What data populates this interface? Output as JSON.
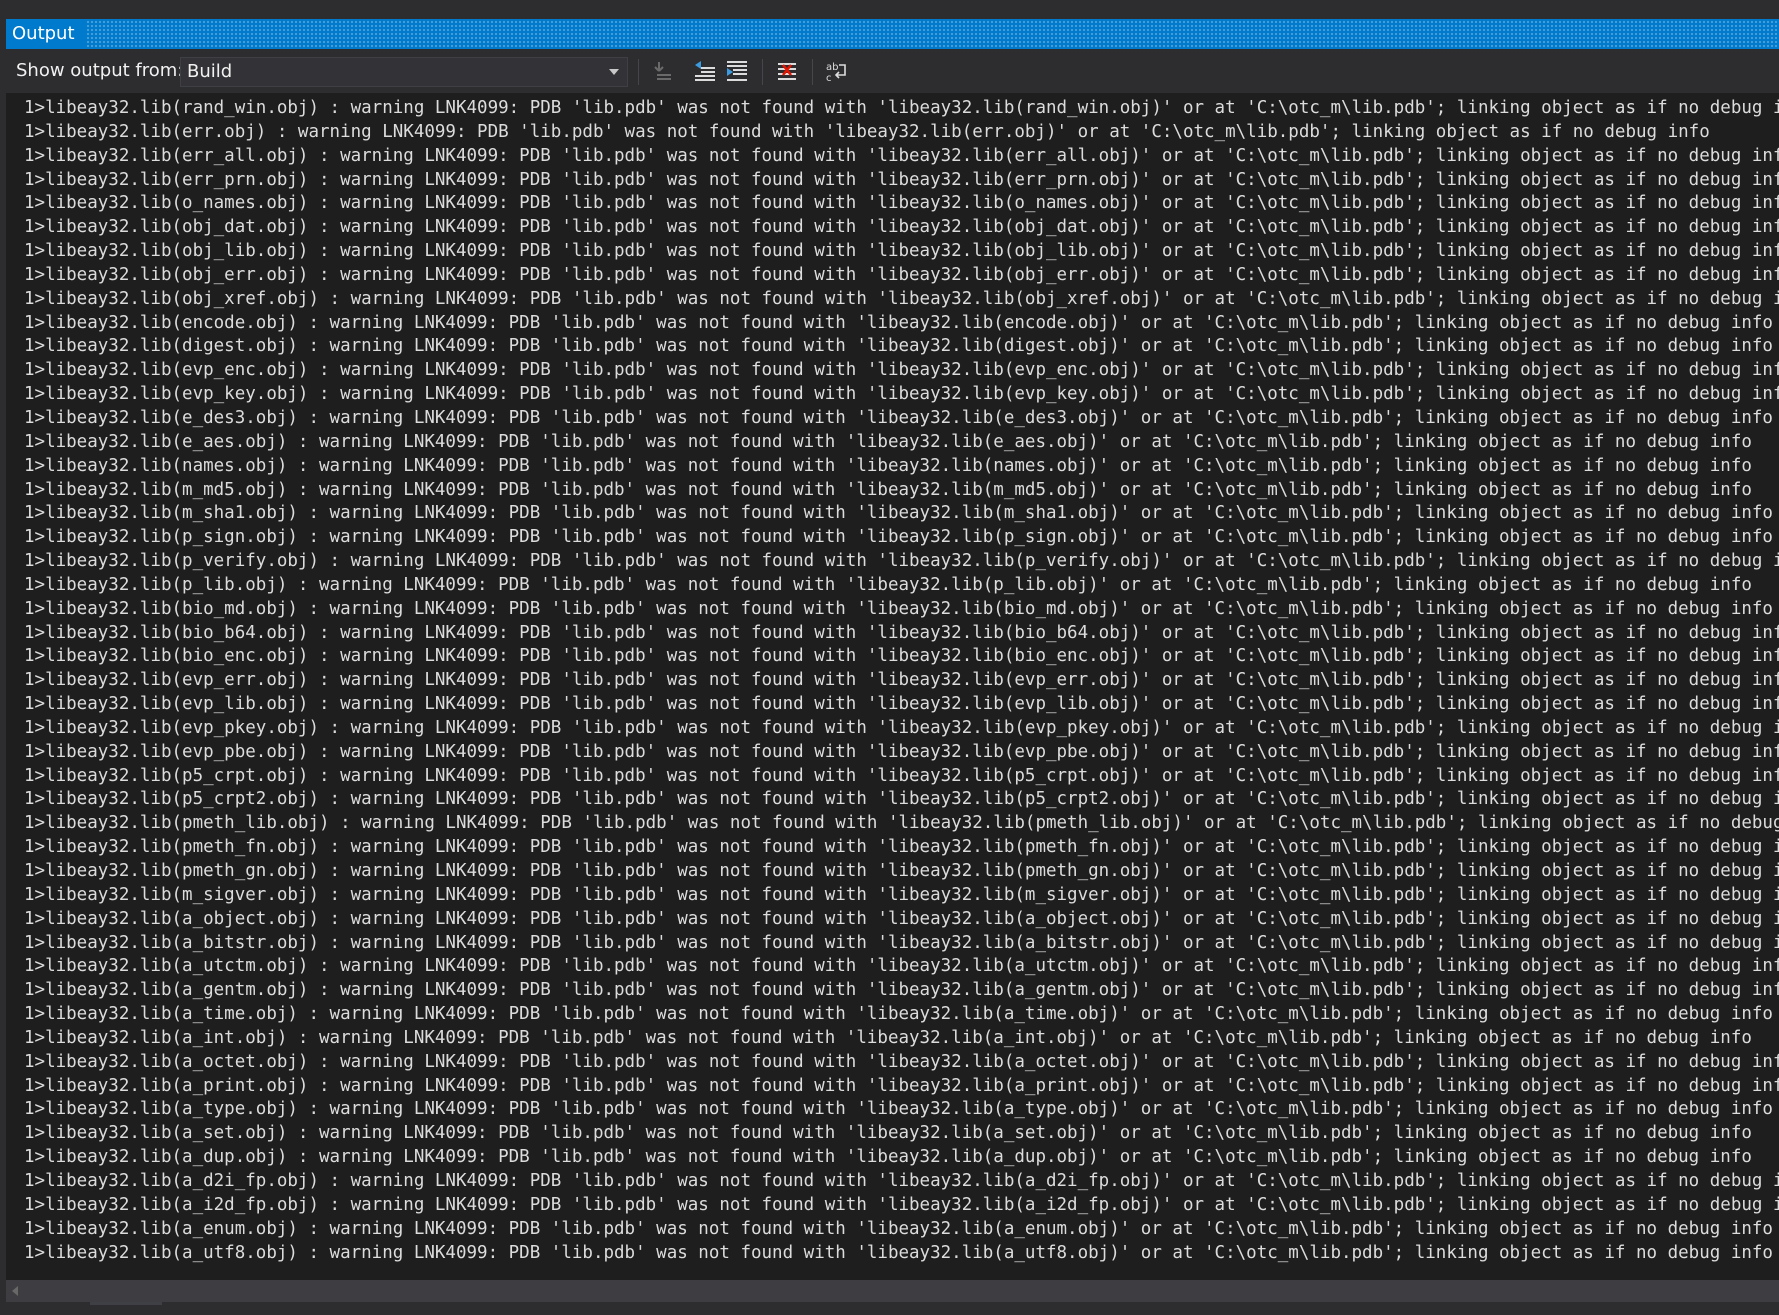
{
  "panel": {
    "title": "Output"
  },
  "toolbar": {
    "show_output_label": "Show output from:",
    "source_selected": "Build"
  },
  "icons": {
    "go_to_message": "go-to-message-icon",
    "previous_message": "previous-message-icon",
    "next_message": "next-message-icon",
    "clear_all": "clear-all-icon",
    "word_wrap": "word-wrap-icon"
  },
  "colors": {
    "accent": "#007acc",
    "background": "#1e1e1e",
    "chrome": "#2d2d30",
    "text": "#dcdcdc"
  },
  "output_lines": [
    "1>libeay32.lib(rand_win.obj) : warning LNK4099: PDB 'lib.pdb' was not found with 'libeay32.lib(rand_win.obj)' or at 'C:\\otc_m\\lib.pdb'; linking object as if no debug info",
    "1>libeay32.lib(err.obj) : warning LNK4099: PDB 'lib.pdb' was not found with 'libeay32.lib(err.obj)' or at 'C:\\otc_m\\lib.pdb'; linking object as if no debug info",
    "1>libeay32.lib(err_all.obj) : warning LNK4099: PDB 'lib.pdb' was not found with 'libeay32.lib(err_all.obj)' or at 'C:\\otc_m\\lib.pdb'; linking object as if no debug info",
    "1>libeay32.lib(err_prn.obj) : warning LNK4099: PDB 'lib.pdb' was not found with 'libeay32.lib(err_prn.obj)' or at 'C:\\otc_m\\lib.pdb'; linking object as if no debug info",
    "1>libeay32.lib(o_names.obj) : warning LNK4099: PDB 'lib.pdb' was not found with 'libeay32.lib(o_names.obj)' or at 'C:\\otc_m\\lib.pdb'; linking object as if no debug info",
    "1>libeay32.lib(obj_dat.obj) : warning LNK4099: PDB 'lib.pdb' was not found with 'libeay32.lib(obj_dat.obj)' or at 'C:\\otc_m\\lib.pdb'; linking object as if no debug info",
    "1>libeay32.lib(obj_lib.obj) : warning LNK4099: PDB 'lib.pdb' was not found with 'libeay32.lib(obj_lib.obj)' or at 'C:\\otc_m\\lib.pdb'; linking object as if no debug info",
    "1>libeay32.lib(obj_err.obj) : warning LNK4099: PDB 'lib.pdb' was not found with 'libeay32.lib(obj_err.obj)' or at 'C:\\otc_m\\lib.pdb'; linking object as if no debug info",
    "1>libeay32.lib(obj_xref.obj) : warning LNK4099: PDB 'lib.pdb' was not found with 'libeay32.lib(obj_xref.obj)' or at 'C:\\otc_m\\lib.pdb'; linking object as if no debug info",
    "1>libeay32.lib(encode.obj) : warning LNK4099: PDB 'lib.pdb' was not found with 'libeay32.lib(encode.obj)' or at 'C:\\otc_m\\lib.pdb'; linking object as if no debug info",
    "1>libeay32.lib(digest.obj) : warning LNK4099: PDB 'lib.pdb' was not found with 'libeay32.lib(digest.obj)' or at 'C:\\otc_m\\lib.pdb'; linking object as if no debug info",
    "1>libeay32.lib(evp_enc.obj) : warning LNK4099: PDB 'lib.pdb' was not found with 'libeay32.lib(evp_enc.obj)' or at 'C:\\otc_m\\lib.pdb'; linking object as if no debug info",
    "1>libeay32.lib(evp_key.obj) : warning LNK4099: PDB 'lib.pdb' was not found with 'libeay32.lib(evp_key.obj)' or at 'C:\\otc_m\\lib.pdb'; linking object as if no debug info",
    "1>libeay32.lib(e_des3.obj) : warning LNK4099: PDB 'lib.pdb' was not found with 'libeay32.lib(e_des3.obj)' or at 'C:\\otc_m\\lib.pdb'; linking object as if no debug info",
    "1>libeay32.lib(e_aes.obj) : warning LNK4099: PDB 'lib.pdb' was not found with 'libeay32.lib(e_aes.obj)' or at 'C:\\otc_m\\lib.pdb'; linking object as if no debug info",
    "1>libeay32.lib(names.obj) : warning LNK4099: PDB 'lib.pdb' was not found with 'libeay32.lib(names.obj)' or at 'C:\\otc_m\\lib.pdb'; linking object as if no debug info",
    "1>libeay32.lib(m_md5.obj) : warning LNK4099: PDB 'lib.pdb' was not found with 'libeay32.lib(m_md5.obj)' or at 'C:\\otc_m\\lib.pdb'; linking object as if no debug info",
    "1>libeay32.lib(m_sha1.obj) : warning LNK4099: PDB 'lib.pdb' was not found with 'libeay32.lib(m_sha1.obj)' or at 'C:\\otc_m\\lib.pdb'; linking object as if no debug info",
    "1>libeay32.lib(p_sign.obj) : warning LNK4099: PDB 'lib.pdb' was not found with 'libeay32.lib(p_sign.obj)' or at 'C:\\otc_m\\lib.pdb'; linking object as if no debug info",
    "1>libeay32.lib(p_verify.obj) : warning LNK4099: PDB 'lib.pdb' was not found with 'libeay32.lib(p_verify.obj)' or at 'C:\\otc_m\\lib.pdb'; linking object as if no debug info",
    "1>libeay32.lib(p_lib.obj) : warning LNK4099: PDB 'lib.pdb' was not found with 'libeay32.lib(p_lib.obj)' or at 'C:\\otc_m\\lib.pdb'; linking object as if no debug info",
    "1>libeay32.lib(bio_md.obj) : warning LNK4099: PDB 'lib.pdb' was not found with 'libeay32.lib(bio_md.obj)' or at 'C:\\otc_m\\lib.pdb'; linking object as if no debug info",
    "1>libeay32.lib(bio_b64.obj) : warning LNK4099: PDB 'lib.pdb' was not found with 'libeay32.lib(bio_b64.obj)' or at 'C:\\otc_m\\lib.pdb'; linking object as if no debug info",
    "1>libeay32.lib(bio_enc.obj) : warning LNK4099: PDB 'lib.pdb' was not found with 'libeay32.lib(bio_enc.obj)' or at 'C:\\otc_m\\lib.pdb'; linking object as if no debug info",
    "1>libeay32.lib(evp_err.obj) : warning LNK4099: PDB 'lib.pdb' was not found with 'libeay32.lib(evp_err.obj)' or at 'C:\\otc_m\\lib.pdb'; linking object as if no debug info",
    "1>libeay32.lib(evp_lib.obj) : warning LNK4099: PDB 'lib.pdb' was not found with 'libeay32.lib(evp_lib.obj)' or at 'C:\\otc_m\\lib.pdb'; linking object as if no debug info",
    "1>libeay32.lib(evp_pkey.obj) : warning LNK4099: PDB 'lib.pdb' was not found with 'libeay32.lib(evp_pkey.obj)' or at 'C:\\otc_m\\lib.pdb'; linking object as if no debug info",
    "1>libeay32.lib(evp_pbe.obj) : warning LNK4099: PDB 'lib.pdb' was not found with 'libeay32.lib(evp_pbe.obj)' or at 'C:\\otc_m\\lib.pdb'; linking object as if no debug info",
    "1>libeay32.lib(p5_crpt.obj) : warning LNK4099: PDB 'lib.pdb' was not found with 'libeay32.lib(p5_crpt.obj)' or at 'C:\\otc_m\\lib.pdb'; linking object as if no debug info",
    "1>libeay32.lib(p5_crpt2.obj) : warning LNK4099: PDB 'lib.pdb' was not found with 'libeay32.lib(p5_crpt2.obj)' or at 'C:\\otc_m\\lib.pdb'; linking object as if no debug info",
    "1>libeay32.lib(pmeth_lib.obj) : warning LNK4099: PDB 'lib.pdb' was not found with 'libeay32.lib(pmeth_lib.obj)' or at 'C:\\otc_m\\lib.pdb'; linking object as if no debug info",
    "1>libeay32.lib(pmeth_fn.obj) : warning LNK4099: PDB 'lib.pdb' was not found with 'libeay32.lib(pmeth_fn.obj)' or at 'C:\\otc_m\\lib.pdb'; linking object as if no debug info",
    "1>libeay32.lib(pmeth_gn.obj) : warning LNK4099: PDB 'lib.pdb' was not found with 'libeay32.lib(pmeth_gn.obj)' or at 'C:\\otc_m\\lib.pdb'; linking object as if no debug info",
    "1>libeay32.lib(m_sigver.obj) : warning LNK4099: PDB 'lib.pdb' was not found with 'libeay32.lib(m_sigver.obj)' or at 'C:\\otc_m\\lib.pdb'; linking object as if no debug info",
    "1>libeay32.lib(a_object.obj) : warning LNK4099: PDB 'lib.pdb' was not found with 'libeay32.lib(a_object.obj)' or at 'C:\\otc_m\\lib.pdb'; linking object as if no debug info",
    "1>libeay32.lib(a_bitstr.obj) : warning LNK4099: PDB 'lib.pdb' was not found with 'libeay32.lib(a_bitstr.obj)' or at 'C:\\otc_m\\lib.pdb'; linking object as if no debug info",
    "1>libeay32.lib(a_utctm.obj) : warning LNK4099: PDB 'lib.pdb' was not found with 'libeay32.lib(a_utctm.obj)' or at 'C:\\otc_m\\lib.pdb'; linking object as if no debug info",
    "1>libeay32.lib(a_gentm.obj) : warning LNK4099: PDB 'lib.pdb' was not found with 'libeay32.lib(a_gentm.obj)' or at 'C:\\otc_m\\lib.pdb'; linking object as if no debug info",
    "1>libeay32.lib(a_time.obj) : warning LNK4099: PDB 'lib.pdb' was not found with 'libeay32.lib(a_time.obj)' or at 'C:\\otc_m\\lib.pdb'; linking object as if no debug info",
    "1>libeay32.lib(a_int.obj) : warning LNK4099: PDB 'lib.pdb' was not found with 'libeay32.lib(a_int.obj)' or at 'C:\\otc_m\\lib.pdb'; linking object as if no debug info",
    "1>libeay32.lib(a_octet.obj) : warning LNK4099: PDB 'lib.pdb' was not found with 'libeay32.lib(a_octet.obj)' or at 'C:\\otc_m\\lib.pdb'; linking object as if no debug info",
    "1>libeay32.lib(a_print.obj) : warning LNK4099: PDB 'lib.pdb' was not found with 'libeay32.lib(a_print.obj)' or at 'C:\\otc_m\\lib.pdb'; linking object as if no debug info",
    "1>libeay32.lib(a_type.obj) : warning LNK4099: PDB 'lib.pdb' was not found with 'libeay32.lib(a_type.obj)' or at 'C:\\otc_m\\lib.pdb'; linking object as if no debug info",
    "1>libeay32.lib(a_set.obj) : warning LNK4099: PDB 'lib.pdb' was not found with 'libeay32.lib(a_set.obj)' or at 'C:\\otc_m\\lib.pdb'; linking object as if no debug info",
    "1>libeay32.lib(a_dup.obj) : warning LNK4099: PDB 'lib.pdb' was not found with 'libeay32.lib(a_dup.obj)' or at 'C:\\otc_m\\lib.pdb'; linking object as if no debug info",
    "1>libeay32.lib(a_d2i_fp.obj) : warning LNK4099: PDB 'lib.pdb' was not found with 'libeay32.lib(a_d2i_fp.obj)' or at 'C:\\otc_m\\lib.pdb'; linking object as if no debug info",
    "1>libeay32.lib(a_i2d_fp.obj) : warning LNK4099: PDB 'lib.pdb' was not found with 'libeay32.lib(a_i2d_fp.obj)' or at 'C:\\otc_m\\lib.pdb'; linking object as if no debug info",
    "1>libeay32.lib(a_enum.obj) : warning LNK4099: PDB 'lib.pdb' was not found with 'libeay32.lib(a_enum.obj)' or at 'C:\\otc_m\\lib.pdb'; linking object as if no debug info",
    "1>libeay32.lib(a_utf8.obj) : warning LNK4099: PDB 'lib.pdb' was not found with 'libeay32.lib(a_utf8.obj)' or at 'C:\\otc_m\\lib.pdb'; linking object as if no debug info"
  ]
}
